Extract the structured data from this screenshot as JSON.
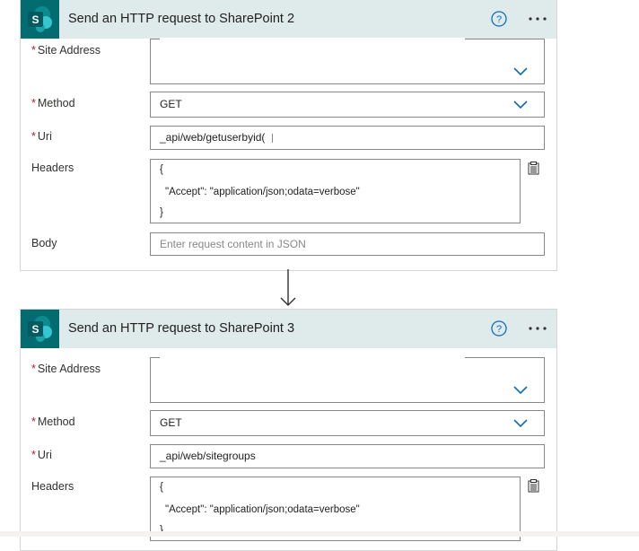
{
  "card1": {
    "title": "Send an HTTP request to SharePoint 2",
    "labels": {
      "site_address": "Site Address",
      "method": "Method",
      "uri": "Uri",
      "headers": "Headers",
      "body": "Body"
    },
    "method_value": "GET",
    "uri_value": "_api/web/getuserbyid(",
    "headers_lines": [
      "{",
      "\"Accept\": \"application/json;odata=verbose\"",
      "}"
    ],
    "body_placeholder": "Enter request content in JSON"
  },
  "card2": {
    "title": "Send an HTTP request to SharePoint 3",
    "labels": {
      "site_address": "Site Address",
      "method": "Method",
      "uri": "Uri",
      "headers": "Headers"
    },
    "method_value": "GET",
    "uri_value": "_api/web/sitegroups",
    "headers_lines": [
      "{",
      "\"Accept\": \"application/json;odata=verbose\"",
      "}"
    ]
  },
  "required_marker": "*",
  "colors": {
    "sharepoint_teal": "#036c70",
    "header_bg": "#dfeaea",
    "accent_blue": "#0f6cbd",
    "required_red": "#a4262c"
  },
  "icons": [
    "sharepoint-icon",
    "help-icon",
    "more-options-icon",
    "chevron-down-icon",
    "clipboard-icon",
    "down-arrow-icon"
  ]
}
